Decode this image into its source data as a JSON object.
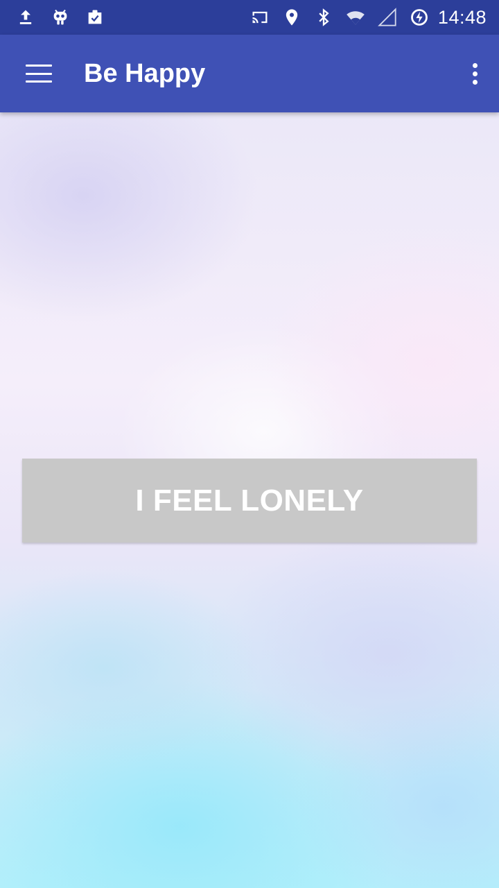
{
  "status_bar": {
    "left_icons": [
      "upload-icon",
      "android-debug-icon",
      "clipboard-check-icon"
    ],
    "right_icons": [
      "cast-icon",
      "location-icon",
      "bluetooth-icon",
      "wifi-icon",
      "cell-signal-icon",
      "battery-charging-icon"
    ],
    "time": "14:48"
  },
  "app_bar": {
    "menu_icon": "hamburger-menu-icon",
    "title": "Be Happy",
    "overflow_icon": "more-vert-icon",
    "background": "#3f51b5"
  },
  "main": {
    "button_label": "I FEEL LONELY",
    "button_color": "#c8c8c8"
  }
}
